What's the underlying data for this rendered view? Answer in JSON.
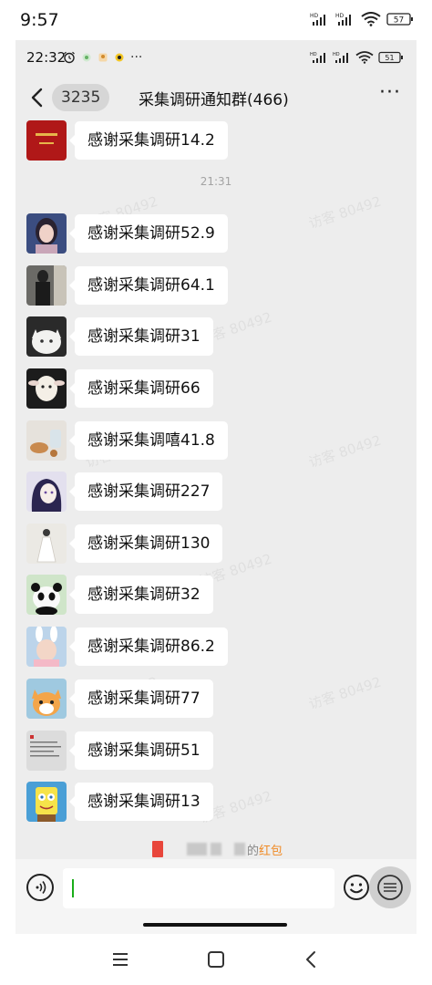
{
  "outer_status": {
    "time": "9:57",
    "battery": "57",
    "signal1": "HD",
    "signal2": "HD"
  },
  "inner_status": {
    "time": "22:32",
    "battery": "51",
    "more": "···",
    "signal1": "HD",
    "signal2": "HD"
  },
  "header": {
    "unread_count": "3235",
    "title": "采集调研通知群(466)",
    "more": "···"
  },
  "time_separator": "21:31",
  "watermark_text": "访客 80492",
  "messages": [
    {
      "text": "感谢采集调研14.2",
      "avatar": "red-greeting-card-avatar"
    },
    {
      "text": "感谢采集调研52.9",
      "avatar": "girl-portrait-avatar"
    },
    {
      "text": "感谢采集调研64.1",
      "avatar": "dark-figure-avatar"
    },
    {
      "text": "感谢采集调研31",
      "avatar": "white-cat-avatar"
    },
    {
      "text": "感谢采集调研66",
      "avatar": "lamb-avatar"
    },
    {
      "text": "感谢采集调嘻41.8",
      "avatar": "food-table-avatar"
    },
    {
      "text": "感谢采集调研227",
      "avatar": "anime-girl-avatar"
    },
    {
      "text": "感谢采集调研130",
      "avatar": "white-dress-avatar"
    },
    {
      "text": "感谢采集调研32",
      "avatar": "panda-avatar"
    },
    {
      "text": "感谢采集调研86.2",
      "avatar": "bunny-ears-child-avatar"
    },
    {
      "text": "感谢采集调研77",
      "avatar": "orange-cat-avatar"
    },
    {
      "text": "感谢采集调研51",
      "avatar": "text-image-avatar"
    },
    {
      "text": "感谢采集调研13",
      "avatar": "spongebob-avatar"
    }
  ],
  "redpacket_note": {
    "suffix": "的",
    "link": "红包"
  },
  "colors": {
    "accent_green": "#1aad19",
    "redpacket_orange": "#f08a24",
    "chat_bg": "#ededed"
  }
}
